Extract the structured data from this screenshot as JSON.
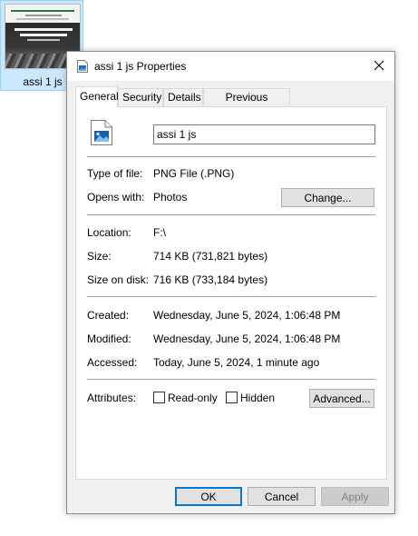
{
  "desktop": {
    "file_label": "assi 1 js"
  },
  "dialog": {
    "title": "assi 1 js Properties",
    "tabs": [
      "General",
      "Security",
      "Details",
      "Previous Versions"
    ],
    "file_name": "assi 1 js",
    "type_label": "Type of file:",
    "type_value": "PNG File (.PNG)",
    "opens_label": "Opens with:",
    "opens_value": "Photos",
    "change_label": "Change...",
    "location_label": "Location:",
    "location_value": "F:\\",
    "size_label": "Size:",
    "size_value": "714 KB (731,821 bytes)",
    "size_on_disk_label": "Size on disk:",
    "size_on_disk_value": "716 KB (733,184 bytes)",
    "created_label": "Created:",
    "created_value": "Wednesday, June 5, 2024, 1:06:48 PM",
    "modified_label": "Modified:",
    "modified_value": "Wednesday, June 5, 2024, 1:06:48 PM",
    "accessed_label": "Accessed:",
    "accessed_value": "Today, June 5, 2024, 1 minute ago",
    "attributes_label": "Attributes:",
    "readonly_label": "Read-only",
    "hidden_label": "Hidden",
    "advanced_label": "Advanced...",
    "ok_label": "OK",
    "cancel_label": "Cancel",
    "apply_label": "Apply"
  },
  "icons": {
    "title": "image-file-icon",
    "file": "image-file-icon",
    "close": "close-icon"
  },
  "colors": {
    "accent": "#0078d7",
    "selection": "#cce8ff"
  }
}
